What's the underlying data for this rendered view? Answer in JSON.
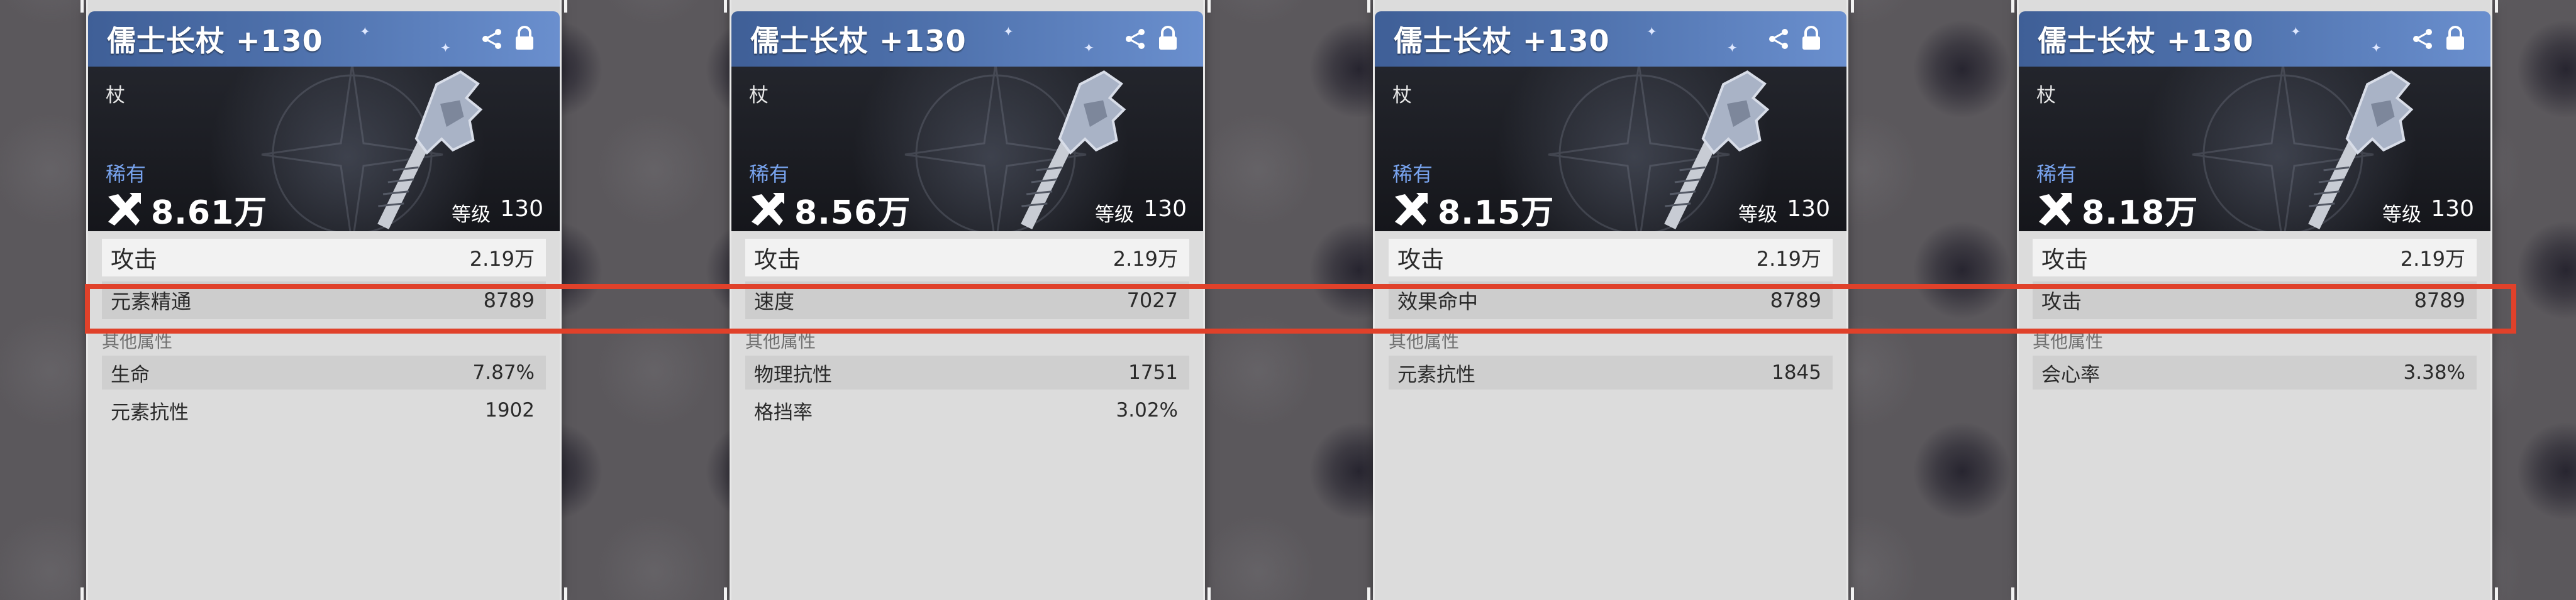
{
  "cards": [
    {
      "title": "儒士长杖 +130",
      "category": "杖",
      "rarity": "稀有",
      "power": "8.61万",
      "level_label": "等级",
      "level": "130",
      "main_stat": {
        "name": "攻击",
        "value": "2.19万"
      },
      "sub_stat": {
        "name": "元素精通",
        "value": "8789"
      },
      "other_header": "其他属性",
      "other_stats": [
        {
          "name": "生命",
          "value": "7.87%"
        },
        {
          "name": "元素抗性",
          "value": "1902"
        }
      ]
    },
    {
      "title": "儒士长杖 +130",
      "category": "杖",
      "rarity": "稀有",
      "power": "8.56万",
      "level_label": "等级",
      "level": "130",
      "main_stat": {
        "name": "攻击",
        "value": "2.19万"
      },
      "sub_stat": {
        "name": "速度",
        "value": "7027"
      },
      "other_header": "其他属性",
      "other_stats": [
        {
          "name": "物理抗性",
          "value": "1751"
        },
        {
          "name": "格挡率",
          "value": "3.02%"
        }
      ]
    },
    {
      "title": "儒士长杖 +130",
      "category": "杖",
      "rarity": "稀有",
      "power": "8.15万",
      "level_label": "等级",
      "level": "130",
      "main_stat": {
        "name": "攻击",
        "value": "2.19万"
      },
      "sub_stat": {
        "name": "效果命中",
        "value": "8789"
      },
      "other_header": "其他属性",
      "other_stats": [
        {
          "name": "元素抗性",
          "value": "1845"
        }
      ]
    },
    {
      "title": "儒士长杖 +130",
      "category": "杖",
      "rarity": "稀有",
      "power": "8.18万",
      "level_label": "等级",
      "level": "130",
      "main_stat": {
        "name": "攻击",
        "value": "2.19万"
      },
      "sub_stat": {
        "name": "攻击",
        "value": "8789"
      },
      "other_header": "其他属性",
      "other_stats": [
        {
          "name": "会心率",
          "value": "3.38%"
        }
      ]
    }
  ],
  "icons": {
    "share": "share-icon",
    "lock": "lock-icon",
    "power": "crossed-tools-icon",
    "art": "staff-weapon-art"
  },
  "colors": {
    "title_bar": "#4f72ad",
    "rarity": "#78a3ee",
    "highlight": "#e0412a",
    "panel": "#dcdcdc"
  }
}
